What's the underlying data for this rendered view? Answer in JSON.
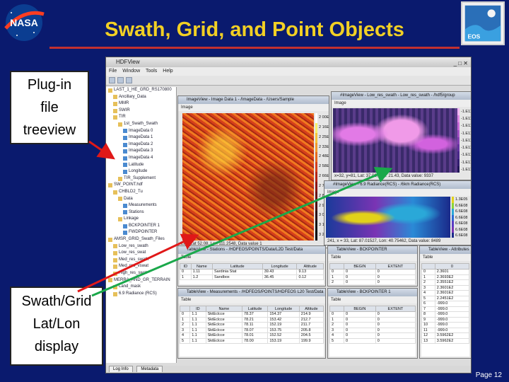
{
  "slide": {
    "title": "Swath, Grid, and Point Objects",
    "page": "Page 12"
  },
  "logos": {
    "left": "NASA",
    "right": "EOS"
  },
  "callouts": {
    "treeview": [
      "Plug-in",
      "file",
      "treeview"
    ],
    "latlon": [
      "Swath/Grid",
      "Lat/Lon",
      "display"
    ]
  },
  "colors": {
    "background": "#0a1a6e",
    "title": "#f2d024",
    "rule": "#c23030",
    "arrow_red": "#e01818",
    "arrow_green": "#1aa84a"
  },
  "app": {
    "title": "HDFView",
    "menu": [
      "File",
      "Window",
      "Tools",
      "Help"
    ],
    "tree": [
      "LAST_1_HE_GRD_RS170800",
      "Ancillary_Data",
      "MMR",
      "SWIR",
      "TIR",
      "1st_Swath_Swath",
      "ImageData 0",
      "ImageData 1",
      "ImageData 2",
      "ImageData 3",
      "ImageData 4",
      "Latitude",
      "Longitude",
      "TIR_Supplement",
      "SW_POINT.hdf",
      "CHBLD2_Tu",
      "Data",
      "Measurements",
      "Stations",
      "Linkage",
      "BCKPOINTER 1",
      "FWDPOINTER",
      "AMSR_GRID_Swath_Files",
      "Low_res_swath",
      "Low_res_swat",
      "Med_res_swath",
      "Med_res_vswat",
      "High_res_swat",
      "MERRA_AND_GR_TERRAIN",
      "Land_mask",
      "6.9 Radiance (RCS)"
    ],
    "swath_window": {
      "title": "ImageView - Image Data 1 - /ImageData - /Users/Sample",
      "status": "Lat:, Lat 52.08, Lon 111.2548, Data value 1",
      "colorbar": [
        "2 00E1",
        "2 16E1",
        "2 25E1",
        "2 33E1",
        "2 48E1",
        "2 58E1",
        "2 66E1",
        "2 75E1",
        "2 84E1",
        "2 96E1",
        "3 04E1",
        "3 14E1",
        "3 22E1"
      ]
    },
    "world_window": {
      "title": "#ImageView - Low_res_swath - Low_res_swath - /hdf5/group",
      "status": "x=32, y=81, Lat: 37.06; Lon: 21.43, Data value: 9337",
      "colorbar": [
        "-1.E11",
        "-1.E11",
        "-1.E11",
        "-1.E11",
        "-1.E11",
        "-1.E11",
        "-1.E11",
        "-1.E11",
        "-1.E11"
      ]
    },
    "grid_window": {
      "title": "#ImageView - 6.9 Radiance(RCS) - /6km Radiance(RCS)",
      "status": "241, x = 33, Lat: 87.01527, Lon: 40.75462, Data value: 8489",
      "colorbar": [
        "1.3E05",
        "6.6E08",
        "6.6E08",
        "6.6E08",
        "6.6E08",
        "6.6E08",
        "6.6E08"
      ]
    },
    "stations_table": {
      "title": "TableView - Stations - /HDFEOS/POINTS/Data/L2D Test/Data",
      "menu": "Table",
      "columns": [
        "ID",
        "Name",
        "Latitude",
        "Longitude",
        "Altitude"
      ],
      "rows": [
        [
          "0",
          "1.11",
          "Sardinia Stat",
          "39.43",
          "9.13"
        ],
        [
          "1",
          "1.2",
          "Sandbox",
          "36.45",
          "0.12"
        ]
      ]
    },
    "measurements_table": {
      "title": "TableView - Measurements - /HDFEOS/POINTS/HDFEOS L20 Test/Data",
      "menu": "Table",
      "columns": [
        "",
        "ID",
        "Name",
        "Latitude",
        "Longitude",
        "Altitude"
      ],
      "rows": [
        [
          "0",
          "1.1",
          "SktEclcce",
          "78.37",
          "154.37",
          "214.9"
        ],
        [
          "1",
          "1.1",
          "SktEclcce",
          "78.21",
          "153.42",
          "212.7"
        ],
        [
          "2",
          "1.1",
          "SktEclcce",
          "78.11",
          "152.19",
          "211.7"
        ],
        [
          "3",
          "1.1",
          "SktEclcce",
          "78.07",
          "153.75",
          "205.8"
        ],
        [
          "4",
          "1.1",
          "SktEclcce",
          "78.01",
          "152.52",
          "204.5"
        ],
        [
          "5",
          "1.1",
          "SktEclcce",
          "78.00",
          "153.19",
          "199.9"
        ]
      ]
    },
    "pointer_table": {
      "title": "TableView - BCKPOINTER",
      "menu": "Table",
      "columns": [
        "",
        "BEGIN",
        "EXTENT"
      ],
      "rows": [
        [
          "0",
          "0",
          "0"
        ],
        [
          "1",
          "0",
          "0"
        ],
        [
          "2",
          "0",
          "0"
        ],
        [
          "3",
          "0",
          "0"
        ]
      ]
    },
    "links_table": {
      "title": "TableView - BCKPOINTER 1",
      "menu": "Table",
      "columns": [
        "",
        "BEGIN",
        "EXTENT"
      ],
      "rows": [
        [
          "0",
          "0",
          "0"
        ],
        [
          "1",
          "0",
          "0"
        ],
        [
          "2",
          "0",
          "0"
        ],
        [
          "3",
          "0",
          "0"
        ],
        [
          "4",
          "0",
          "0"
        ],
        [
          "5",
          "0",
          "0"
        ]
      ]
    },
    "values_table": {
      "title": "TableView - Attributes",
      "menu": "Table",
      "columns": [
        "",
        "0"
      ],
      "rows": [
        [
          "0",
          "2.3601"
        ],
        [
          "1",
          "2.3693E2"
        ],
        [
          "2",
          "2.3551E2"
        ],
        [
          "3",
          "2.3601E2"
        ],
        [
          "4",
          "2.3601E2"
        ],
        [
          "5",
          "2.2451E2"
        ],
        [
          "6",
          "-999.0"
        ],
        [
          "7",
          "-999.0"
        ],
        [
          "8",
          "-999.0"
        ],
        [
          "9",
          "-999.0"
        ],
        [
          "10",
          "-999.0"
        ],
        [
          "11",
          "-999.0"
        ],
        [
          "12",
          "3.5962E2"
        ],
        [
          "13",
          "3.5962E2"
        ]
      ]
    },
    "bottom_tabs": [
      "Log Info",
      "Metadata"
    ]
  }
}
